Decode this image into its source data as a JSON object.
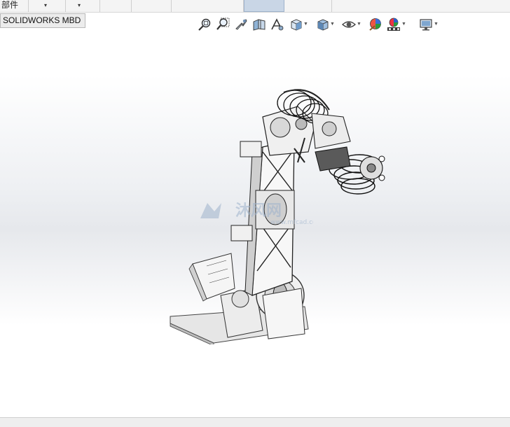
{
  "toolbar": {
    "part_label": "部件",
    "dropdown_a_caret": "▾",
    "dropdown_b_caret": "▾"
  },
  "mbd_tab": {
    "label": "SOLIDWORKS MBD"
  },
  "heads_up_toolbar": {
    "buttons": [
      "zoom-to-fit-icon",
      "zoom-to-area-icon",
      "previous-view-icon",
      "section-view-icon",
      "dynamic-annotation-icon",
      "view-orientation-icon",
      "display-style-icon",
      "hide-show-items-icon",
      "edit-appearance-icon",
      "apply-scene-icon",
      "view-settings-icon"
    ]
  },
  "watermark": {
    "brand": "沐风网",
    "url": "www.mfcad.com"
  }
}
